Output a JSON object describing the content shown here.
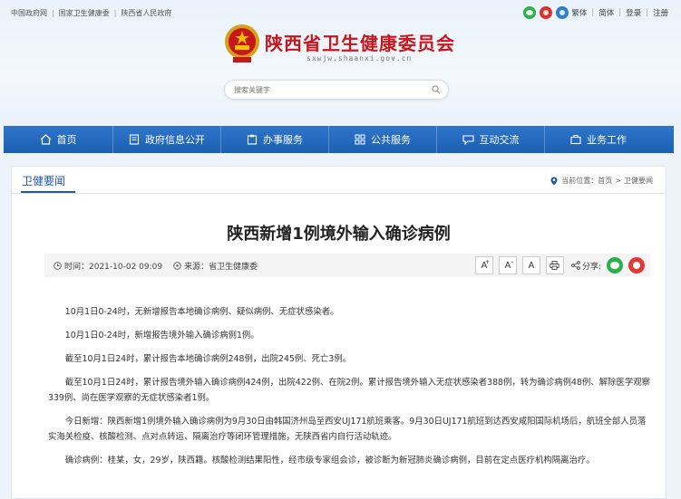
{
  "topbar": {
    "links": [
      "中国政府网",
      "国家卫生健康委",
      "陕西省人民政府"
    ],
    "sep": "|",
    "lang_traditional": "繁体",
    "lang_simplified": "简体",
    "login": "登录",
    "register": "注册"
  },
  "header": {
    "title": "陕西省卫生健康委员会",
    "domain": "sxwjw.shaanxi.gov.cn",
    "search_placeholder": "搜索关键字"
  },
  "nav": {
    "items": [
      "首页",
      "政府信息公开",
      "办事服务",
      "公共服务",
      "互动交流",
      "业务工作"
    ]
  },
  "section": {
    "title": "卫健要闻",
    "breadcrumb_label": "当前位置：",
    "breadcrumb_home": "首页",
    "breadcrumb_gt": ">",
    "breadcrumb_current": "卫健要闻"
  },
  "article": {
    "title": "陕西新增1例境外输入确诊病例",
    "time": "时间：2021-10-02 09:09",
    "source": "来源：省卫生健康委",
    "font_large": "A",
    "font_medium": "A",
    "font_small": "A",
    "share_label": "分享:",
    "paragraphs": [
      "10月1日0-24时，无新增报告本地确诊病例、疑似病例、无症状感染者。",
      "10月1日0-24时，新增报告境外输入确诊病例1例。",
      "截至10月1日24时，累计报告本地确诊病例248例，出院245例、死亡3例。",
      "截至10月1日24时，累计报告境外输入确诊病例424例，出院422例、在院2例。累计报告境外输入无症状感染者388例，转为确诊病例48例、解除医学观察339例、尚在医学观察的无症状感染者1例。",
      "今日新增：陕西新增1例境外输入确诊病例为9月30日由韩国济州岛至西安UJ171航班乘客。9月30日UJ171航班到达西安咸阳国际机场后，航班全部人员落实海关检疫、核酸检测、点对点转运、隔离治疗等闭环管理措施，无陕西省内自行活动轨迹。",
      "确诊病例：桂某，女，29岁，陕西籍。核酸检测结果阳性，经市级专家组会诊，被诊断为新冠肺炎确诊病例，目前在定点医疗机构隔离治疗。"
    ]
  },
  "colors": {
    "nav_blue": "#1b5fb3",
    "title_red": "#c8161d",
    "section_blue": "#1f5aa6"
  }
}
